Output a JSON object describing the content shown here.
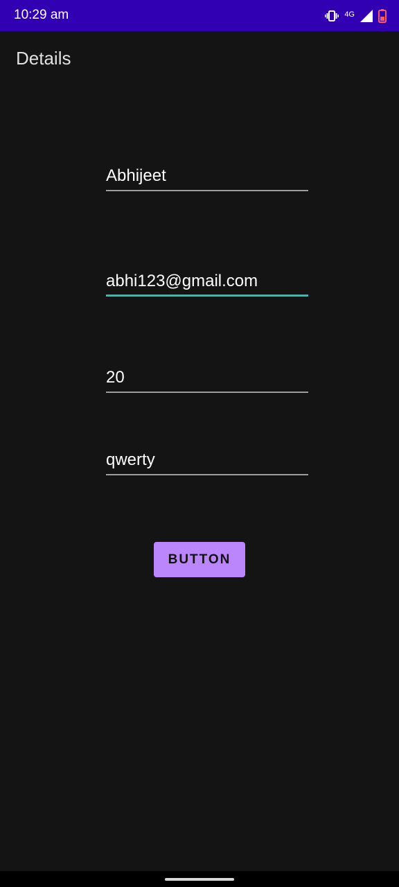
{
  "status_bar": {
    "time": "10:29 am",
    "network": "4G",
    "background_color": "#3200b3",
    "icons": [
      "vibrate-icon",
      "network-4g-icon",
      "signal-icon",
      "battery-icon"
    ]
  },
  "app_bar": {
    "title": "Details"
  },
  "form": {
    "name_value": "Abhijeet",
    "email_value": "abhi123@gmail.com",
    "age_value": "20",
    "password_value": "qwerty",
    "focused_field": "email",
    "focus_color": "#1fc7b6"
  },
  "button": {
    "label": "BUTTON",
    "color": "#bb86fc"
  }
}
